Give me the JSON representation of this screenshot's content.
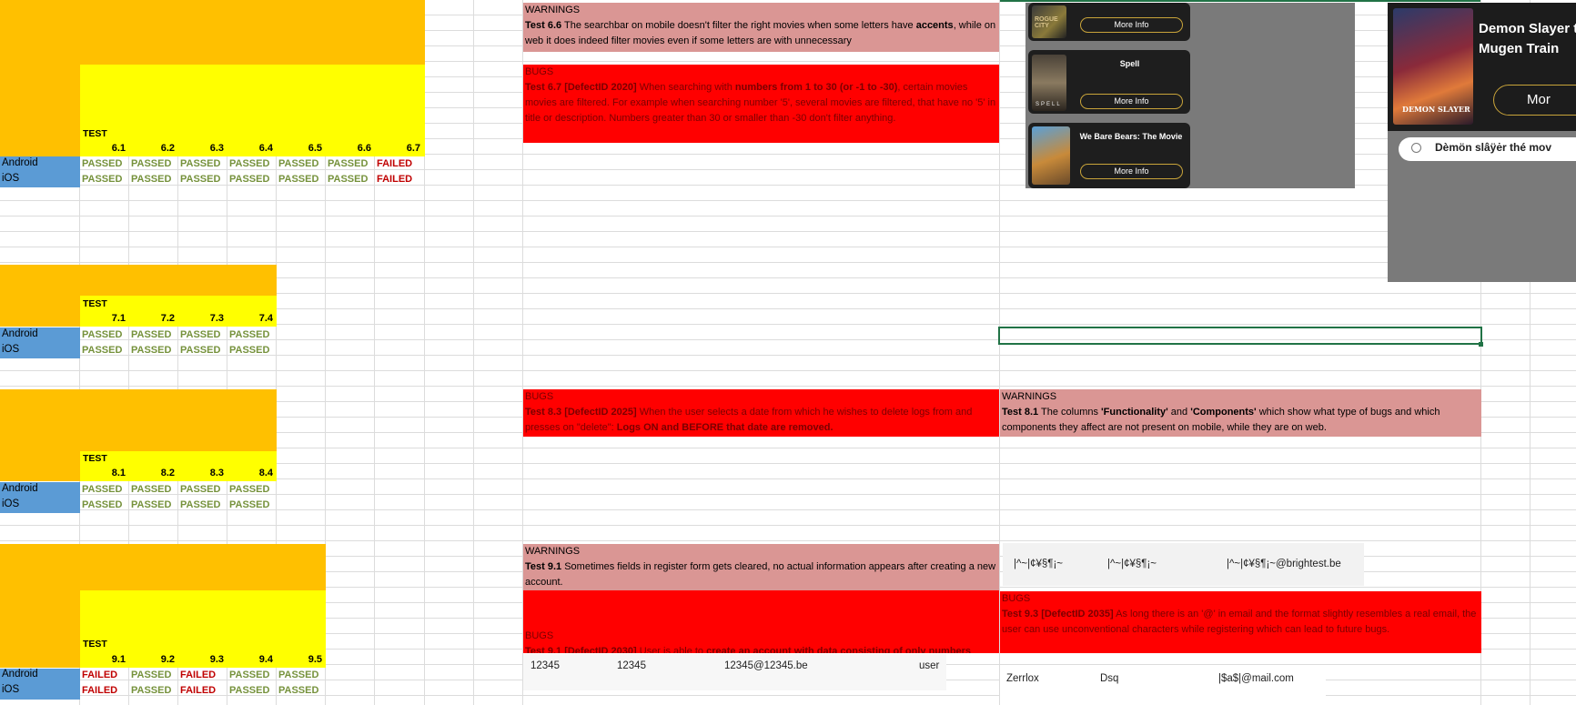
{
  "section6": {
    "test_label": "TEST",
    "tests": [
      "6.1",
      "6.2",
      "6.3",
      "6.4",
      "6.5",
      "6.6",
      "6.7"
    ],
    "android_label": "Android",
    "ios_label": "iOS",
    "android": [
      "PASSED",
      "PASSED",
      "PASSED",
      "PASSED",
      "PASSED",
      "PASSED",
      "FAILED"
    ],
    "ios": [
      "PASSED",
      "PASSED",
      "PASSED",
      "PASSED",
      "PASSED",
      "PASSED",
      "FAILED"
    ]
  },
  "section7": {
    "test_label": "TEST",
    "tests": [
      "7.1",
      "7.2",
      "7.3",
      "7.4"
    ],
    "android_label": "Android",
    "ios_label": "iOS",
    "android": [
      "PASSED",
      "PASSED",
      "PASSED",
      "PASSED"
    ],
    "ios": [
      "PASSED",
      "PASSED",
      "PASSED",
      "PASSED"
    ]
  },
  "section8": {
    "test_label": "TEST",
    "tests": [
      "8.1",
      "8.2",
      "8.3",
      "8.4"
    ],
    "android_label": "Android",
    "ios_label": "iOS",
    "android": [
      "PASSED",
      "PASSED",
      "PASSED",
      "PASSED"
    ],
    "ios": [
      "PASSED",
      "PASSED",
      "PASSED",
      "PASSED"
    ]
  },
  "section9": {
    "test_label": "TEST",
    "tests": [
      "9.1",
      "9.2",
      "9.3",
      "9.4",
      "9.5"
    ],
    "android_label": "Android",
    "ios_label": "iOS",
    "android": [
      "FAILED",
      "PASSED",
      "FAILED",
      "PASSED",
      "PASSED"
    ],
    "ios": [
      "FAILED",
      "PASSED",
      "FAILED",
      "PASSED",
      "PASSED"
    ]
  },
  "notes": {
    "w66_title": "WARNINGS",
    "w66_id": "Test 6.6",
    "w66_text1": " The searchbar on mobile doesn't filter the right movies when some letters have ",
    "w66_bold": "accents",
    "w66_text2": ", while on web it does indeed filter movies even if some letters are with unnecessary",
    "b67_title": "BUGS",
    "b67_id": "Test 6.7 [DefectID 2020]",
    "b67_text1": " When searching with ",
    "b67_bold": "numbers from 1 to 30 (or -1 to -30)",
    "b67_text2": ", certain movies movies are filtered. For example when searching number '5', several movies are filtered, that have no '5' in title or description. Numbers greater than 30 or smaller than -30 don't filter anything.",
    "b83_title": "BUGS",
    "b83_id": "Test 8.3 [DefectID 2025]",
    "b83_text1": " When the user selects a date from which he wishes to delete logs from and presses on \"delete\": ",
    "b83_bold": "Logs ON and BEFORE that date are removed.",
    "w81_title": "WARNINGS",
    "w81_id": "Test 8.1",
    "w81_text1": " The columns ",
    "w81_bold1": "'Functionality'",
    "w81_text2": " and ",
    "w81_bold2": "'Components'",
    "w81_text3": " which show what type of bugs and which components they affect are not present on mobile, while they are on web.",
    "w91_title": "WARNINGS",
    "w91_id": "Test 9.1",
    "w91_text": " Sometimes fields in register form gets cleared, no actual information appears after creating a new account.",
    "b91_title": "BUGS",
    "b91_id": "Test 9.1 [DefectID 2030]",
    "b91_text1": " User is able to ",
    "b91_bold": "create an account with data consisting of only numbers",
    "b93_title": "BUGS",
    "b93_id": "Test 9.3 [DefectID 2035]",
    "b93_text": " As long there is an '@' in email and the format slightly resembles a real email, the user can use unconventional characters while registering which can lead to future bugs."
  },
  "screenshot_movies": {
    "card1_button": "More Info",
    "card1_poster_text": "ROGUE CITY",
    "card2_title": "Spell",
    "card2_button": "More Info",
    "card2_poster_text": "SPELL",
    "card3_title": "We Bare Bears: The Movie",
    "card3_button": "More Info"
  },
  "screenshot_search": {
    "title_line1": "Demon Slayer t",
    "title_line2": "Mugen Train",
    "button_partial": "Mor",
    "search_value": "Dèmön slâÿėr thé mov",
    "poster_logo": "DEMON SLAYER"
  },
  "form_rows": {
    "row1": [
      "|^~|¢¥§¶¡~",
      "|^~|¢¥§¶¡~",
      "|^~|¢¥§¶¡~@brightest.be"
    ],
    "row2": [
      "12345",
      "12345",
      "12345@12345.be",
      "user"
    ],
    "row3": [
      "Zerrlox",
      "Dsq",
      "|$a$|@mail.com"
    ]
  }
}
